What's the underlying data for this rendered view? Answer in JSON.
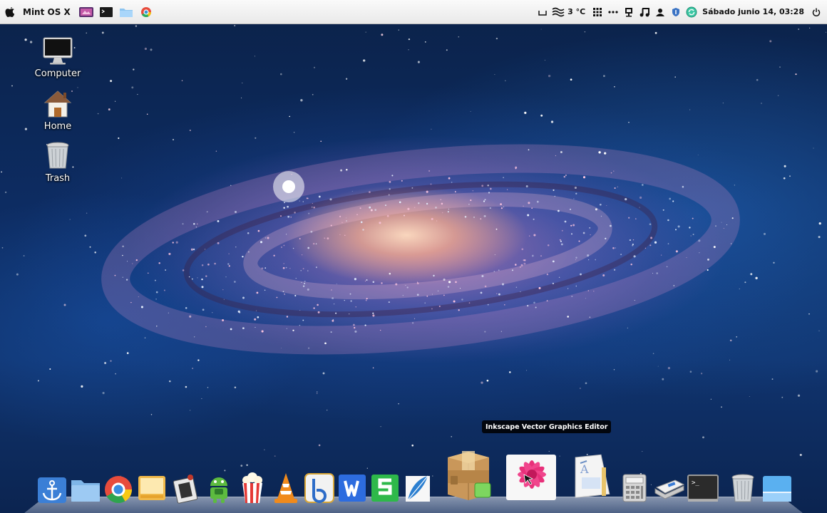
{
  "top_bar": {
    "os_name": "Mint OS X",
    "temperature": "3 °C",
    "clock": "Sábado junio 14, 03:28",
    "left_icons": [
      "apple-logo-icon",
      "media-player-icon",
      "terminal-icon",
      "folder-icon",
      "chrome-icon"
    ],
    "tray_icons": [
      "show-desktop-icon",
      "wifi-icon",
      "weather-icon",
      "apps-grid-icon",
      "more-dots-icon",
      "network-icon",
      "music-icon",
      "user-icon",
      "shield-icon",
      "update-icon",
      "power-icon"
    ]
  },
  "desktop": {
    "icons": [
      {
        "label": "Computer",
        "icon": "computer-icon"
      },
      {
        "label": "Home",
        "icon": "home-icon"
      },
      {
        "label": "Trash",
        "icon": "trash-icon"
      }
    ]
  },
  "tooltip": {
    "text": "Inkscape Vector Graphics Editor"
  },
  "dock": {
    "items": [
      "anchor-icon",
      "files-icon",
      "chrome-icon",
      "screen-icon",
      "tool-icon",
      "android-icon",
      "popcorn-icon",
      "vlc-icon",
      "bluefish-icon",
      "writer-icon",
      "spreadsheet-icon",
      "feather-icon",
      "package-icon",
      "inkscape-icon",
      "document-viewer-icon",
      "calculator-icon",
      "scanner-icon",
      "terminal-icon",
      "trash-icon",
      "desktop-icon"
    ]
  },
  "colors": {
    "top_bar_bg": "#ececec",
    "wallpaper_base": "#0d2c62",
    "galaxy_core": "#ffd9bf"
  }
}
